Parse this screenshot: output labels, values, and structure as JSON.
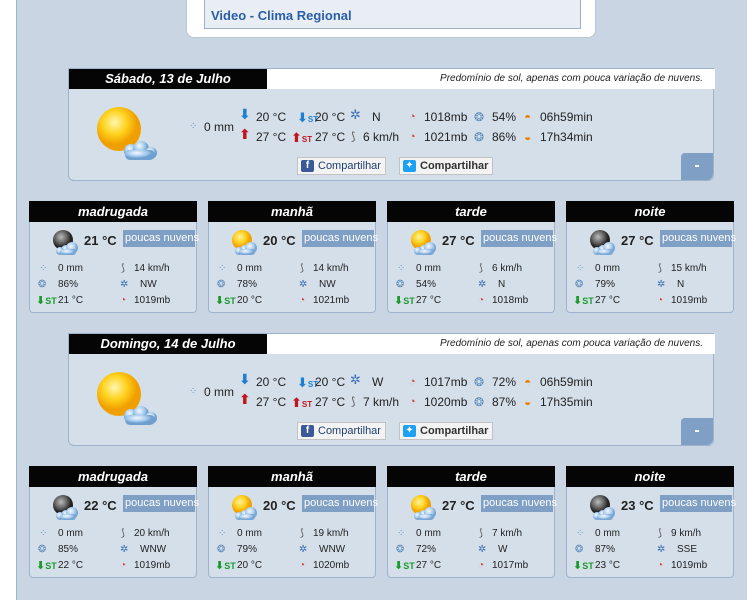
{
  "video": {
    "link": "Video - Clima Regional"
  },
  "share": {
    "facebook": "Compartilhar",
    "twitter": "Compartilhar",
    "fb_glyph": "f"
  },
  "collapse_label": "-",
  "days": [
    {
      "title": "Sábado, 13 de Julho",
      "desc": "Predomínio de sol, apenas com pouca variação de nuvens.",
      "rain": "0 mm",
      "temp_min": "20 °C",
      "temp_max": "27 °C",
      "feel_min": "20 °C",
      "feel_max": "27 °C",
      "wind_dir": "N",
      "wind_speed": "6 km/h",
      "pressure_1": "1018mb",
      "pressure_2": "1021mb",
      "humidity_1": "54%",
      "humidity_2": "86%",
      "sunrise": "06h59min",
      "sunset": "17h34min",
      "periods": [
        {
          "name": "madrugada",
          "temp": "21 °C",
          "cond": "poucas nuvens",
          "icon": "moon-cloud-icon",
          "rain": "0 mm",
          "hum": "86%",
          "feel": "21 °C",
          "wind": "14 km/h",
          "dir": "NW",
          "press": "1019mb"
        },
        {
          "name": "manhã",
          "temp": "20 °C",
          "cond": "poucas nuvens",
          "icon": "sun-cloud-icon",
          "rain": "0 mm",
          "hum": "78%",
          "feel": "20 °C",
          "wind": "14 km/h",
          "dir": "NW",
          "press": "1021mb"
        },
        {
          "name": "tarde",
          "temp": "27 °C",
          "cond": "poucas nuvens",
          "icon": "sun-cloud-icon",
          "rain": "0 mm",
          "hum": "54%",
          "feel": "27 °C",
          "wind": "6 km/h",
          "dir": "N",
          "press": "1018mb"
        },
        {
          "name": "noite",
          "temp": "27 °C",
          "cond": "poucas nuvens",
          "icon": "moon-cloud-icon",
          "rain": "0 mm",
          "hum": "79%",
          "feel": "27 °C",
          "wind": "15 km/h",
          "dir": "N",
          "press": "1019mb"
        }
      ]
    },
    {
      "title": "Domingo, 14 de Julho",
      "desc": "Predomínio de sol, apenas com pouca variação de nuvens.",
      "rain": "0 mm",
      "temp_min": "20 °C",
      "temp_max": "27 °C",
      "feel_min": "20 °C",
      "feel_max": "27 °C",
      "wind_dir": "W",
      "wind_speed": "7 km/h",
      "pressure_1": "1017mb",
      "pressure_2": "1020mb",
      "humidity_1": "72%",
      "humidity_2": "87%",
      "sunrise": "06h59min",
      "sunset": "17h35min",
      "periods": [
        {
          "name": "madrugada",
          "temp": "22 °C",
          "cond": "poucas nuvens",
          "icon": "moon-cloud-icon",
          "rain": "0 mm",
          "hum": "85%",
          "feel": "22 °C",
          "wind": "20 km/h",
          "dir": "WNW",
          "press": "1019mb"
        },
        {
          "name": "manhã",
          "temp": "20 °C",
          "cond": "poucas nuvens",
          "icon": "sun-cloud-icon",
          "rain": "0 mm",
          "hum": "79%",
          "feel": "20 °C",
          "wind": "19 km/h",
          "dir": "WNW",
          "press": "1020mb"
        },
        {
          "name": "tarde",
          "temp": "27 °C",
          "cond": "poucas nuvens",
          "icon": "sun-cloud-icon",
          "rain": "0 mm",
          "hum": "72%",
          "feel": "27 °C",
          "wind": "7 km/h",
          "dir": "W",
          "press": "1017mb"
        },
        {
          "name": "noite",
          "temp": "23 °C",
          "cond": "poucas nuvens",
          "icon": "moon-cloud-icon",
          "rain": "0 mm",
          "hum": "87%",
          "feel": "23 °C",
          "wind": "9 km/h",
          "dir": "SSE",
          "press": "1019mb"
        }
      ]
    }
  ]
}
